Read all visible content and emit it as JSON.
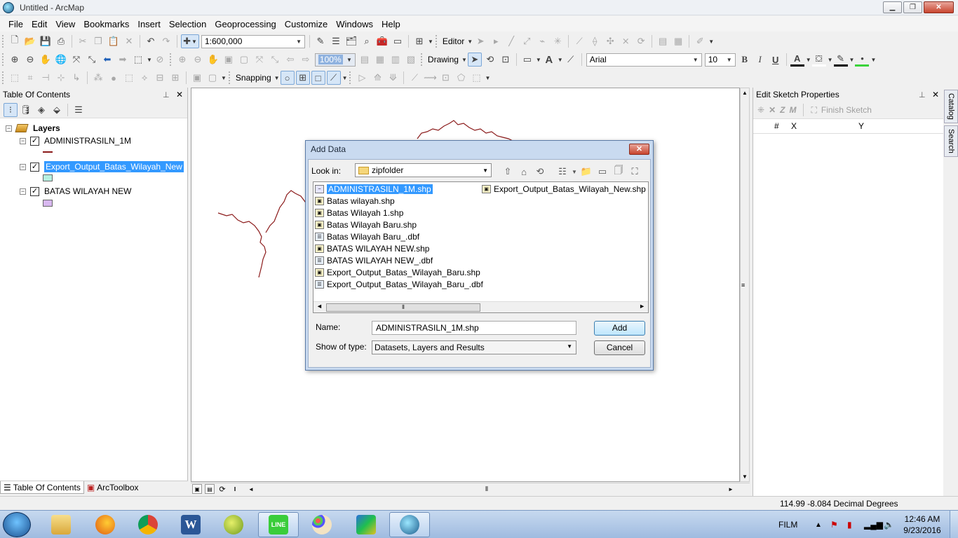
{
  "window": {
    "title": "Untitled - ArcMap",
    "minimize": "▁",
    "maximize": "❐",
    "close": "✕"
  },
  "menu": [
    "File",
    "Edit",
    "View",
    "Bookmarks",
    "Insert",
    "Selection",
    "Geoprocessing",
    "Customize",
    "Windows",
    "Help"
  ],
  "toolbar": {
    "scale": "1:600,000",
    "editor_label": "Editor",
    "drawing_label": "Drawing",
    "font_name": "Arial",
    "font_size": "10",
    "bold": "B",
    "italic": "I",
    "underline": "U",
    "text_tool": "A",
    "zoom_pct": "100%",
    "snapping_label": "Snapping"
  },
  "toc": {
    "title": "Table Of Contents",
    "root": "Layers",
    "layers": [
      {
        "name": "ADMINISTRASILN_1M",
        "checked": true,
        "symbol": "line",
        "color": "#8b1a1a"
      },
      {
        "name": "Export_Output_Batas_Wilayah_New",
        "checked": true,
        "symbol": "fill",
        "color": "#b5f0e0",
        "selected": true
      },
      {
        "name": "BATAS WILAYAH NEW",
        "checked": true,
        "symbol": "fill",
        "color": "#d8b8f0"
      }
    ],
    "tabs": [
      "Table Of Contents",
      "ArcToolbox"
    ]
  },
  "sketch_panel": {
    "title": "Edit Sketch Properties",
    "finish_sketch": "Finish Sketch",
    "columns": [
      "#",
      "X",
      "Y"
    ]
  },
  "side_tabs": [
    "Catalog",
    "Search"
  ],
  "status": {
    "coords": "114.99  -8.084 Decimal Degrees"
  },
  "dialog": {
    "title": "Add Data",
    "look_in_label": "Look in:",
    "look_in_value": "zipfolder",
    "files_col1": [
      {
        "name": "ADMINISTRASILN_1M.shp",
        "type": "line",
        "selected": true
      },
      {
        "name": "Batas wilayah.shp",
        "type": "shp"
      },
      {
        "name": "Batas Wilayah 1.shp",
        "type": "shp"
      },
      {
        "name": "Batas Wilayah Baru.shp",
        "type": "shp"
      },
      {
        "name": "Batas Wilayah Baru_.dbf",
        "type": "dbf"
      },
      {
        "name": "BATAS WILAYAH NEW.shp",
        "type": "shp"
      },
      {
        "name": "BATAS WILAYAH NEW_.dbf",
        "type": "dbf"
      },
      {
        "name": "Export_Output_Batas_Wilayah_Baru.shp",
        "type": "shp"
      },
      {
        "name": "Export_Output_Batas_Wilayah_Baru_.dbf",
        "type": "dbf"
      }
    ],
    "files_col2": [
      {
        "name": "Export_Output_Batas_Wilayah_New.shp",
        "type": "shp"
      }
    ],
    "name_label": "Name:",
    "name_value": "ADMINISTRASILN_1M.shp",
    "type_label": "Show of type:",
    "type_value": "Datasets, Layers and Results",
    "add_button": "Add",
    "cancel_button": "Cancel"
  },
  "taskbar": {
    "apps": [
      "Windows Explorer",
      "Firefox",
      "Chrome",
      "Word",
      "ArcGIS",
      "LINE",
      "Paint",
      "Image Viewer",
      "ArcMap"
    ],
    "word_glyph": "W",
    "line_glyph": "LINE",
    "tray_label": "FILM",
    "time": "12:46 AM",
    "date": "9/23/2016"
  }
}
